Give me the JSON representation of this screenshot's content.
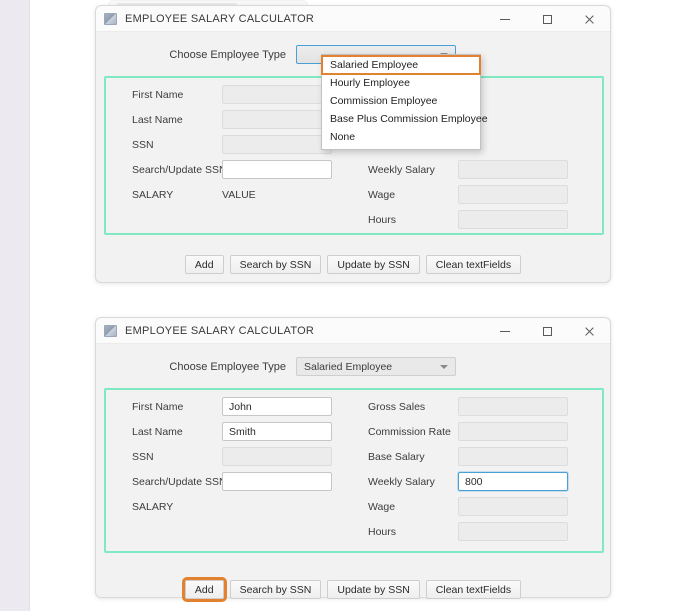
{
  "window1": {
    "title": "EMPLOYEE SALARY CALCULATOR",
    "icon": "app-icon",
    "controls": {
      "minimize": "minimize-icon",
      "maximize": "maximize-icon",
      "close": "close-icon"
    },
    "combo": {
      "label": "Choose Employee Type",
      "value": "",
      "arrow": "chevron-down-icon",
      "open": true,
      "options": [
        "Salaried Employee",
        "Hourly Employee",
        "Commission Employee",
        "Base Plus Commission Employee",
        "None"
      ],
      "highlighted_option": "Salaried Employee"
    },
    "left_fields": [
      {
        "label": "First Name",
        "value": "",
        "style": "readonly"
      },
      {
        "label": "Last Name",
        "value": "",
        "style": "readonly"
      },
      {
        "label": "SSN",
        "value": "",
        "style": "readonly"
      },
      {
        "label": "Search/Update SSN",
        "value": "",
        "style": "editable"
      }
    ],
    "salary_label": "SALARY",
    "salary_value": "VALUE",
    "right_fields": [
      {
        "label": "Weekly Salary",
        "value": "",
        "style": "readonly"
      },
      {
        "label": "Wage",
        "value": "",
        "style": "readonly"
      },
      {
        "label": "Hours",
        "value": "",
        "style": "readonly"
      }
    ],
    "buttons": [
      {
        "label": "Add",
        "marked": false
      },
      {
        "label": "Search by SSN",
        "marked": false
      },
      {
        "label": "Update by SSN",
        "marked": false
      },
      {
        "label": "Clean textFields",
        "marked": false
      }
    ]
  },
  "window2": {
    "title": "EMPLOYEE SALARY CALCULATOR",
    "icon": "app-icon",
    "controls": {
      "minimize": "minimize-icon",
      "maximize": "maximize-icon",
      "close": "close-icon"
    },
    "combo": {
      "label": "Choose Employee Type",
      "value": "Salaried Employee",
      "arrow": "chevron-down-icon",
      "open": false
    },
    "left_fields": [
      {
        "label": "First Name",
        "value": "John",
        "style": "editable"
      },
      {
        "label": "Last Name",
        "value": "Smith",
        "style": "editable"
      },
      {
        "label": "SSN",
        "value": "",
        "style": "readonly"
      },
      {
        "label": "Search/Update SSN",
        "value": "",
        "style": "editable"
      }
    ],
    "salary_label": "SALARY",
    "salary_value": "",
    "right_fields": [
      {
        "label": "Gross Sales",
        "value": "",
        "style": "readonly"
      },
      {
        "label": "Commission Rate",
        "value": "",
        "style": "readonly"
      },
      {
        "label": "Base Salary",
        "value": "",
        "style": "readonly"
      },
      {
        "label": "Weekly Salary",
        "value": "800",
        "style": "focused"
      },
      {
        "label": "Wage",
        "value": "",
        "style": "readonly"
      },
      {
        "label": "Hours",
        "value": "",
        "style": "readonly"
      }
    ],
    "buttons": [
      {
        "label": "Add",
        "marked": true
      },
      {
        "label": "Search by SSN",
        "marked": false
      },
      {
        "label": "Update by SSN",
        "marked": false
      },
      {
        "label": "Clean textFields",
        "marked": false
      }
    ]
  },
  "colors": {
    "teal_highlight": "#7fe9c2",
    "orange_marker": "#e2822f",
    "focus_blue": "#4a9fd6",
    "window_bg": "#f2f2f2"
  }
}
